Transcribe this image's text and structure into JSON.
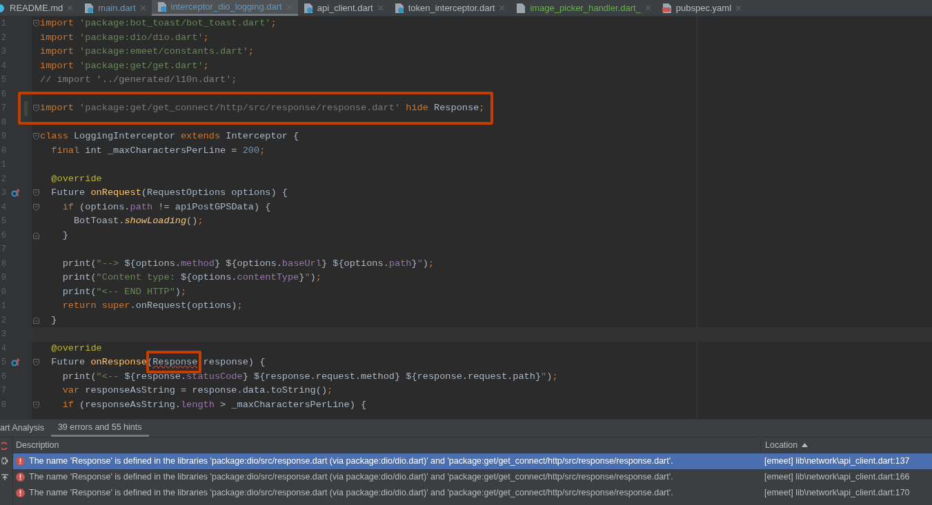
{
  "tabs": [
    {
      "label": "README.md",
      "kind": "markdown",
      "color": "#bbbbbb",
      "selected": false
    },
    {
      "label": "main.dart",
      "kind": "dart",
      "color": "#6897bb",
      "selected": false
    },
    {
      "label": "interceptor_dio_logging.dart",
      "kind": "dart",
      "color": "#6897bb",
      "selected": true
    },
    {
      "label": "api_client.dart",
      "kind": "dart",
      "color": "#bbbbbb",
      "selected": false
    },
    {
      "label": "token_interceptor.dart",
      "kind": "dart",
      "color": "#bbbbbb",
      "selected": false
    },
    {
      "label": "image_picker_handler.dart_",
      "kind": "plain",
      "color": "#62b543",
      "selected": false
    },
    {
      "label": "pubspec.yaml",
      "kind": "yaml",
      "color": "#bbbbbb",
      "selected": false
    }
  ],
  "editor": {
    "lines": [
      {
        "n": "1",
        "expanded": true,
        "code": [
          {
            "kind": "keyword",
            "text": "import "
          },
          {
            "kind": "string",
            "text": "'package:bot_toast/bot_toast.dart'"
          },
          {
            "kind": "keyword",
            "text": ";"
          }
        ]
      },
      {
        "n": "2",
        "code": [
          {
            "kind": "keyword",
            "text": "import "
          },
          {
            "kind": "string",
            "text": "'package:dio/dio.dart'"
          },
          {
            "kind": "keyword",
            "text": ";"
          }
        ]
      },
      {
        "n": "3",
        "code": [
          {
            "kind": "keyword",
            "text": "import "
          },
          {
            "kind": "string",
            "text": "'package:emeet/constants.dart'"
          },
          {
            "kind": "keyword",
            "text": ";"
          }
        ]
      },
      {
        "n": "4",
        "code": [
          {
            "kind": "keyword",
            "text": "import "
          },
          {
            "kind": "string",
            "text": "'package:get/get.dart'"
          },
          {
            "kind": "keyword",
            "text": ";"
          }
        ]
      },
      {
        "n": "5",
        "code": [
          {
            "kind": "comment",
            "text": "// import '../generated/l10n.dart';"
          }
        ]
      },
      {
        "n": "6"
      },
      {
        "n": "7",
        "expanded": true,
        "changed": true,
        "boxed": true,
        "code": [
          {
            "kind": "keyword",
            "text": "import "
          },
          {
            "kind": "unused",
            "text": "'package:get/get_connect/http/src/response/response.dart'"
          },
          {
            "kind": "keyword",
            "text": " hide "
          },
          {
            "kind": "plain",
            "text": "Response"
          },
          {
            "kind": "keyword",
            "text": ";"
          }
        ]
      },
      {
        "n": "8"
      },
      {
        "n": "9",
        "expanded": true,
        "code": [
          {
            "kind": "keyword",
            "text": "class "
          },
          {
            "kind": "plain",
            "text": "LoggingInterceptor "
          },
          {
            "kind": "keyword",
            "text": "extends "
          },
          {
            "kind": "plain",
            "text": "Interceptor {"
          }
        ]
      },
      {
        "n": "0",
        "code": [
          {
            "kind": "keyword",
            "text": "  final "
          },
          {
            "kind": "plain",
            "text": "int _maxCharactersPerLine = "
          },
          {
            "kind": "number",
            "text": "200"
          },
          {
            "kind": "keyword",
            "text": ";"
          }
        ]
      },
      {
        "n": "1"
      },
      {
        "n": "2",
        "code": [
          {
            "kind": "annotation",
            "text": "  @override"
          }
        ]
      },
      {
        "n": "3",
        "expanded": true,
        "overrides": true,
        "code": [
          {
            "kind": "plain",
            "text": "  Future "
          },
          {
            "kind": "function",
            "text": "onRequest"
          },
          {
            "kind": "plain",
            "text": "(RequestOptions options) {"
          }
        ]
      },
      {
        "n": "4",
        "expanded": true,
        "code": [
          {
            "kind": "keyword",
            "text": "    if "
          },
          {
            "kind": "plain",
            "text": "(options."
          },
          {
            "kind": "field",
            "text": "path"
          },
          {
            "kind": "plain",
            "text": " != apiPostGPSData) {"
          }
        ]
      },
      {
        "n": "5",
        "code": [
          {
            "kind": "plain",
            "text": "      BotToast."
          },
          {
            "kind": "static",
            "text": "showLoading"
          },
          {
            "kind": "plain",
            "text": "()"
          },
          {
            "kind": "keyword",
            "text": ";"
          }
        ]
      },
      {
        "n": "6",
        "fold_end": true,
        "code": [
          {
            "kind": "plain",
            "text": "    }"
          }
        ]
      },
      {
        "n": "7"
      },
      {
        "n": "8",
        "code": [
          {
            "kind": "plain",
            "text": "    print("
          },
          {
            "kind": "string",
            "text": "\"--> "
          },
          {
            "kind": "plain",
            "text": "${options."
          },
          {
            "kind": "field",
            "text": "method"
          },
          {
            "kind": "plain",
            "text": "} ${options."
          },
          {
            "kind": "field",
            "text": "baseUrl"
          },
          {
            "kind": "plain",
            "text": "} ${options."
          },
          {
            "kind": "field",
            "text": "path"
          },
          {
            "kind": "plain",
            "text": "}"
          },
          {
            "kind": "string",
            "text": "\""
          },
          {
            "kind": "plain",
            "text": ")"
          },
          {
            "kind": "keyword",
            "text": ";"
          }
        ]
      },
      {
        "n": "9",
        "code": [
          {
            "kind": "plain",
            "text": "    print("
          },
          {
            "kind": "string",
            "text": "\"Content type: "
          },
          {
            "kind": "plain",
            "text": "${options."
          },
          {
            "kind": "field",
            "text": "contentType"
          },
          {
            "kind": "plain",
            "text": "}"
          },
          {
            "kind": "string",
            "text": "\""
          },
          {
            "kind": "plain",
            "text": ")"
          },
          {
            "kind": "keyword",
            "text": ";"
          }
        ]
      },
      {
        "n": "0",
        "code": [
          {
            "kind": "plain",
            "text": "    print("
          },
          {
            "kind": "string",
            "text": "\"<-- END HTTP\""
          },
          {
            "kind": "plain",
            "text": ")"
          },
          {
            "kind": "keyword",
            "text": ";"
          }
        ]
      },
      {
        "n": "1",
        "code": [
          {
            "kind": "keyword",
            "text": "    return super"
          },
          {
            "kind": "plain",
            "text": ".onRequest(options)"
          },
          {
            "kind": "keyword",
            "text": ";"
          }
        ]
      },
      {
        "n": "2",
        "fold_end": true,
        "code": [
          {
            "kind": "plain",
            "text": "  }"
          }
        ]
      },
      {
        "n": "3",
        "current": true
      },
      {
        "n": "4",
        "code": [
          {
            "kind": "annotation",
            "text": "  @override"
          }
        ]
      },
      {
        "n": "5",
        "expanded": true,
        "overrides": true,
        "code": [
          {
            "kind": "plain",
            "text": "  Future "
          },
          {
            "kind": "function",
            "text": "onResponse"
          },
          {
            "kind": "plain",
            "text": "("
          },
          {
            "kind": "error",
            "text": "Response",
            "boxed": true
          },
          {
            "kind": "plain",
            "text": " response) {"
          }
        ]
      },
      {
        "n": "6",
        "code": [
          {
            "kind": "plain",
            "text": "    print("
          },
          {
            "kind": "string",
            "text": "\"<-- "
          },
          {
            "kind": "plain",
            "text": "${response."
          },
          {
            "kind": "field",
            "text": "statusCode"
          },
          {
            "kind": "plain",
            "text": "} ${response.request.method} ${response.request.path}"
          },
          {
            "kind": "string",
            "text": "\""
          },
          {
            "kind": "plain",
            "text": ")"
          },
          {
            "kind": "keyword",
            "text": ";"
          }
        ]
      },
      {
        "n": "7",
        "code": [
          {
            "kind": "keyword",
            "text": "    var "
          },
          {
            "kind": "plain",
            "text": "responseAsString = response.data.toString()"
          },
          {
            "kind": "keyword",
            "text": ";"
          }
        ]
      },
      {
        "n": "8",
        "expanded": true,
        "code": [
          {
            "kind": "keyword",
            "text": "    if "
          },
          {
            "kind": "plain",
            "text": "(responseAsString."
          },
          {
            "kind": "field",
            "text": "length"
          },
          {
            "kind": "plain",
            "text": " > _maxCharactersPerLine) {"
          }
        ]
      }
    ]
  },
  "panel": {
    "tabs": [
      {
        "label": "art Analysis",
        "selected": false
      },
      {
        "label": "39 errors and 55 hints",
        "selected": true
      }
    ],
    "columns": [
      "Description",
      "Location"
    ],
    "rows": [
      {
        "description": "The name 'Response' is defined in the libraries 'package:dio/src/response.dart (via package:dio/dio.dart)' and 'package:get/get_connect/http/src/response/response.dart'.",
        "location": "[emeet] lib\\network\\api_client.dart:137",
        "selected": true
      },
      {
        "description": "The name 'Response' is defined in the libraries 'package:dio/src/response.dart (via package:dio/dio.dart)' and 'package:get/get_connect/http/src/response/response.dart'.",
        "location": "[emeet] lib\\network\\api_client.dart:166",
        "selected": false
      },
      {
        "description": "The name 'Response' is defined in the libraries 'package:dio/src/response.dart (via package:dio/dio.dart)' and 'package:get/get_connect/http/src/response/response.dart'.",
        "location": "[emeet] lib\\network\\api_client.dart:170",
        "selected": false
      }
    ]
  }
}
